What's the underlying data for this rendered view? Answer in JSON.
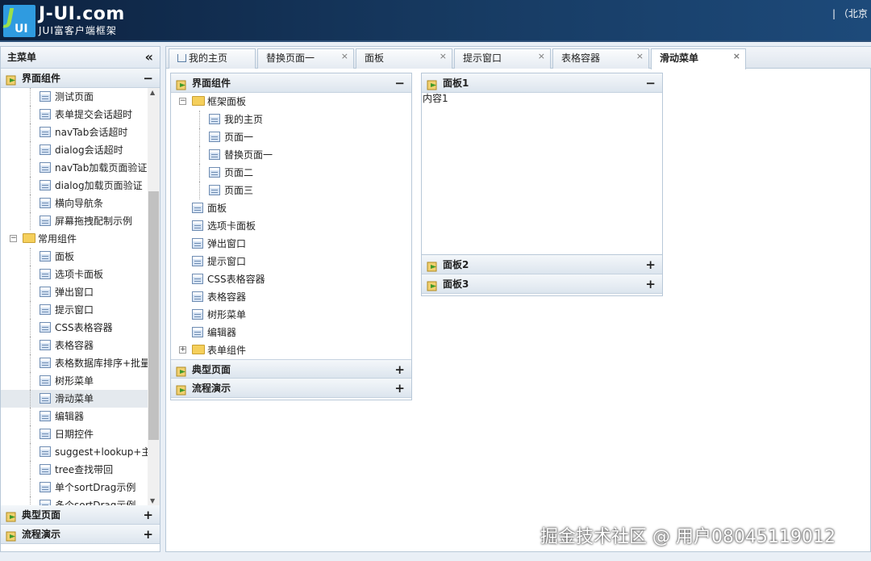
{
  "header": {
    "logo_s": "J",
    "logo_ui": "UI",
    "brand": "J-UI.com",
    "subtitle": "JUI富客户端框架",
    "right_text": "|  （北京"
  },
  "sidebar": {
    "title": "主菜单",
    "collapse_glyph": "«",
    "sections": [
      {
        "label": "界面组件",
        "toggle": "−"
      },
      {
        "label": "典型页面",
        "toggle": "+"
      },
      {
        "label": "流程演示",
        "toggle": "+"
      }
    ],
    "tree": [
      {
        "label": "测试页面",
        "type": "leaf",
        "level": 2
      },
      {
        "label": "表单提交会话超时",
        "type": "leaf",
        "level": 2
      },
      {
        "label": "navTab会话超时",
        "type": "leaf",
        "level": 2
      },
      {
        "label": "dialog会话超时",
        "type": "leaf",
        "level": 2
      },
      {
        "label": "navTab加载页面验证",
        "type": "leaf",
        "level": 2
      },
      {
        "label": "dialog加载页面验证",
        "type": "leaf",
        "level": 2
      },
      {
        "label": "横向导航条",
        "type": "leaf",
        "level": 2
      },
      {
        "label": "屏幕拖拽配制示例",
        "type": "leaf",
        "level": 2
      },
      {
        "label": "常用组件",
        "type": "folder",
        "level": 1,
        "expander": "−"
      },
      {
        "label": "面板",
        "type": "leaf",
        "level": 2
      },
      {
        "label": "选项卡面板",
        "type": "leaf",
        "level": 2
      },
      {
        "label": "弹出窗口",
        "type": "leaf",
        "level": 2
      },
      {
        "label": "提示窗口",
        "type": "leaf",
        "level": 2
      },
      {
        "label": "CSS表格容器",
        "type": "leaf",
        "level": 2
      },
      {
        "label": "表格容器",
        "type": "leaf",
        "level": 2
      },
      {
        "label": "表格数据库排序+批量",
        "type": "leaf",
        "level": 2
      },
      {
        "label": "树形菜单",
        "type": "leaf",
        "level": 2
      },
      {
        "label": "滑动菜单",
        "type": "leaf",
        "level": 2,
        "selected": true
      },
      {
        "label": "编辑器",
        "type": "leaf",
        "level": 2
      },
      {
        "label": "日期控件",
        "type": "leaf",
        "level": 2
      },
      {
        "label": "suggest+lookup+主",
        "type": "leaf",
        "level": 2
      },
      {
        "label": "tree查找带回",
        "type": "leaf",
        "level": 2
      },
      {
        "label": "单个sortDrag示例",
        "type": "leaf",
        "level": 2
      },
      {
        "label": "多个sortDrag示例",
        "type": "leaf",
        "level": 2
      }
    ]
  },
  "tabs": [
    {
      "label": "我的主页",
      "home": true,
      "closable": false
    },
    {
      "label": "替换页面一",
      "closable": true
    },
    {
      "label": "面板",
      "closable": true
    },
    {
      "label": "提示窗口",
      "closable": true
    },
    {
      "label": "表格容器",
      "closable": true
    },
    {
      "label": "滑动菜单",
      "closable": true,
      "active": true
    }
  ],
  "tab_close_glyph": "×",
  "left_accordion": {
    "sections": [
      {
        "label": "界面组件",
        "toggle": "−"
      },
      {
        "label": "典型页面",
        "toggle": "+"
      },
      {
        "label": "流程演示",
        "toggle": "+"
      }
    ],
    "tree": [
      {
        "label": "框架面板",
        "type": "folder",
        "level": 1,
        "expander": "−"
      },
      {
        "label": "我的主页",
        "type": "leaf",
        "level": 2
      },
      {
        "label": "页面一",
        "type": "leaf",
        "level": 2
      },
      {
        "label": "替换页面一",
        "type": "leaf",
        "level": 2
      },
      {
        "label": "页面二",
        "type": "leaf",
        "level": 2
      },
      {
        "label": "页面三",
        "type": "leaf",
        "level": 2
      },
      {
        "label": "面板",
        "type": "leaf",
        "level": 1
      },
      {
        "label": "选项卡面板",
        "type": "leaf",
        "level": 1
      },
      {
        "label": "弹出窗口",
        "type": "leaf",
        "level": 1
      },
      {
        "label": "提示窗口",
        "type": "leaf",
        "level": 1
      },
      {
        "label": "CSS表格容器",
        "type": "leaf",
        "level": 1
      },
      {
        "label": "表格容器",
        "type": "leaf",
        "level": 1
      },
      {
        "label": "树形菜单",
        "type": "leaf",
        "level": 1
      },
      {
        "label": "编辑器",
        "type": "leaf",
        "level": 1
      },
      {
        "label": "表单组件",
        "type": "folder",
        "level": 1,
        "expander": "+"
      }
    ]
  },
  "right_accordion": {
    "sections": [
      {
        "label": "面板1",
        "toggle": "−",
        "content": "内容1"
      },
      {
        "label": "面板2",
        "toggle": "+"
      },
      {
        "label": "面板3",
        "toggle": "+"
      }
    ]
  },
  "watermark": "掘金技术社区 @ 用户08045119012",
  "colors": {
    "header_bg": "#0d2240",
    "accent_green": "#5aa02c",
    "folder": "#f5cf5b",
    "panel_border": "#b8c8d8"
  }
}
